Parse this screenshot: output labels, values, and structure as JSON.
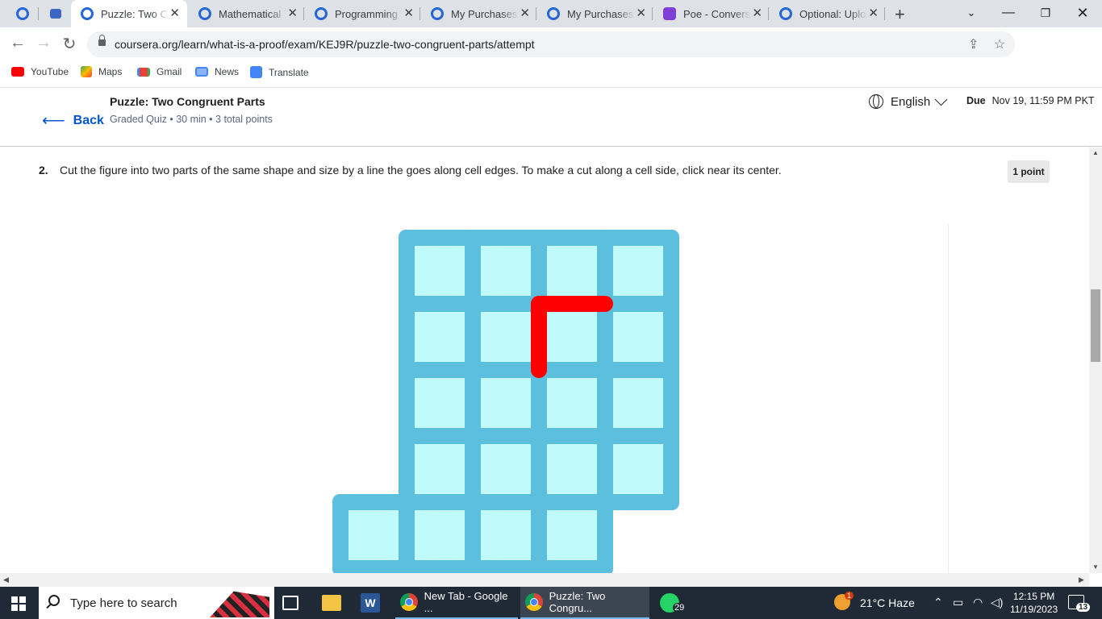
{
  "browser": {
    "tabs": [
      {
        "title": "",
        "active": false
      },
      {
        "title": "",
        "active": false
      },
      {
        "title": "Puzzle: Two Congruent Parts",
        "active": true
      },
      {
        "title": "Mathematical Thinking",
        "active": false
      },
      {
        "title": "Programming",
        "active": false
      },
      {
        "title": "My Purchases",
        "active": false
      },
      {
        "title": "My Purchases",
        "active": false
      },
      {
        "title": "Poe - Conversation",
        "active": false
      },
      {
        "title": "Optional: Upload",
        "active": false
      }
    ],
    "url": "coursera.org/learn/what-is-a-proof/exam/KEJ9R/puzzle-two-congruent-parts/attempt",
    "bookmarks": [
      "YouTube",
      "Maps",
      "Gmail",
      "News",
      "Translate"
    ]
  },
  "header": {
    "back_label": "Back",
    "title": "Puzzle: Two Congruent Parts",
    "meta": "Graded Quiz • 30 min • 3 total points",
    "language": "English",
    "due_label": "Due",
    "due_date": "Nov 19, 11:59 PM PKT"
  },
  "question": {
    "number": "2.",
    "text": "Cut the figure into two parts of the same shape and size by a line the goes along cell edges. To make a cut along a cell side, click near its center.",
    "points": "1 point"
  },
  "puzzle": {
    "colors": {
      "frame": "#5bbfdd",
      "cell": "#c1fafa",
      "cut": "#ff0000"
    },
    "cells": [
      [
        1,
        0
      ],
      [
        2,
        0
      ],
      [
        3,
        0
      ],
      [
        4,
        0
      ],
      [
        1,
        1
      ],
      [
        2,
        1
      ],
      [
        3,
        1
      ],
      [
        4,
        1
      ],
      [
        1,
        2
      ],
      [
        2,
        2
      ],
      [
        3,
        2
      ],
      [
        4,
        2
      ],
      [
        1,
        3
      ],
      [
        2,
        3
      ],
      [
        3,
        3
      ],
      [
        4,
        3
      ],
      [
        0,
        4
      ],
      [
        1,
        4
      ],
      [
        2,
        4
      ],
      [
        3,
        4
      ]
    ],
    "cuts": [
      {
        "from": [
          3,
          1
        ],
        "to": [
          4,
          1
        ]
      },
      {
        "from": [
          3,
          1
        ],
        "to": [
          3,
          2
        ]
      }
    ]
  },
  "taskbar": {
    "search_placeholder": "Type here to search",
    "apps": [
      {
        "label": "New Tab - Google ...",
        "active": false
      },
      {
        "label": "Puzzle: Two Congru...",
        "active": true
      }
    ],
    "whatsapp_badge": "29",
    "weather_badge": "1",
    "weather": "21°C  Haze",
    "time": "12:15 PM",
    "date": "11/19/2023",
    "notifications": "13"
  }
}
